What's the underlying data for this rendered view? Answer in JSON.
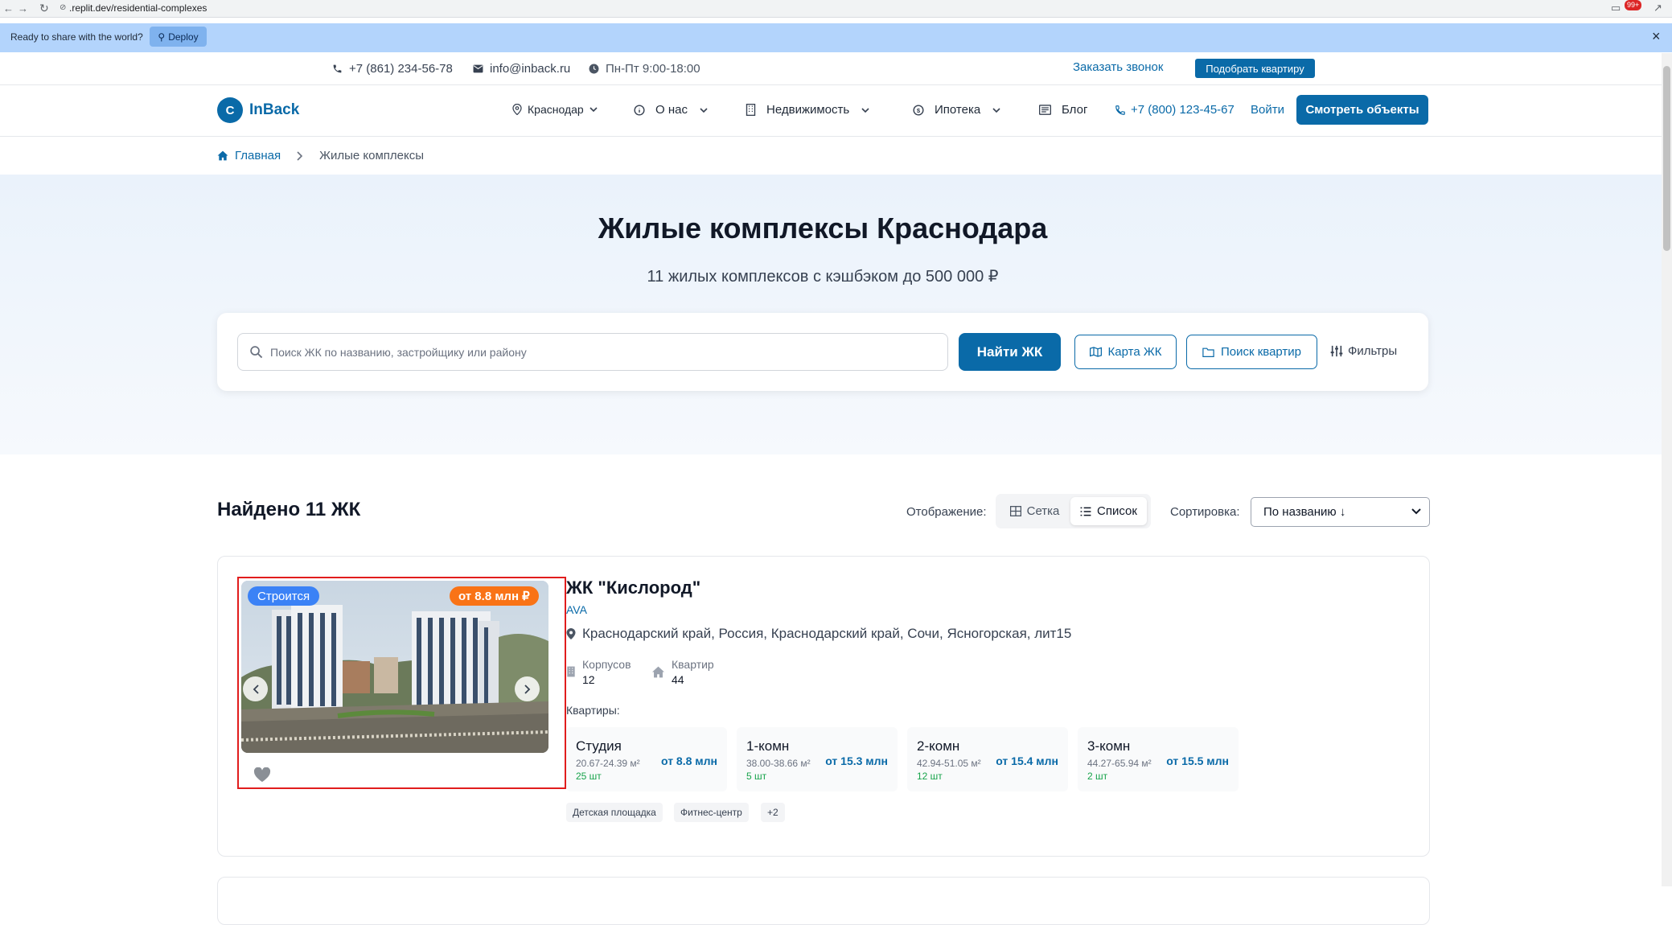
{
  "browser": {
    "url": ".replit.dev/residential-complexes",
    "notification_count": "99+"
  },
  "share_bar": {
    "text": "Ready to share with the world?",
    "deploy_label": "Deploy"
  },
  "topbar": {
    "phone": "+7 (861) 234-56-78",
    "email": "info@inback.ru",
    "hours": "Пн-Пт 9:00-18:00",
    "order_call": "Заказать звонок",
    "pick_flat": "Подобрать квартиру"
  },
  "nav": {
    "logo_letter": "C",
    "logo_text": "InBack",
    "city": "Краснодар",
    "about": "О нас",
    "realty": "Недвижимость",
    "mortgage": "Ипотека",
    "blog": "Блог",
    "phone": "+7 (800) 123-45-67",
    "login": "Войти",
    "cta": "Смотреть объекты"
  },
  "breadcrumb": {
    "home": "Главная",
    "current": "Жилые комплексы"
  },
  "hero": {
    "title": "Жилые комплексы Краснодара",
    "subtitle": "11 жилых комплексов с кэшбэком до 500 000 ₽"
  },
  "search": {
    "placeholder": "Поиск ЖК по названию, застройщику или району",
    "value": "",
    "find_button": "Найти ЖК",
    "map_button": "Карта ЖК",
    "flats_button": "Поиск квартир",
    "filters_button": "Фильтры"
  },
  "results": {
    "found": "Найдено 11 ЖК",
    "display_label": "Отображение:",
    "view_grid": "Сетка",
    "view_list": "Список",
    "sort_label": "Сортировка:",
    "sort_value": "По названию ↓"
  },
  "complex": {
    "status": "Строится",
    "price_badge": "от 8.8 млн ₽",
    "name": "ЖК \"Кислород\"",
    "developer": "AVA",
    "address": "Краснодарский край, Россия, Краснодарский край, Сочи, Ясногорская, лит15",
    "buildings_label": "Корпусов",
    "buildings_value": "12",
    "flats_count_label": "Квартир",
    "flats_count_value": "44",
    "flats_label": "Квартиры:",
    "flat_types": [
      {
        "type": "Студия",
        "area": "20.67-24.39 м²",
        "count": "25 шт",
        "price": "от 8.8 млн"
      },
      {
        "type": "1-комн",
        "area": "38.00-38.66 м²",
        "count": "5 шт",
        "price": "от 15.3 млн"
      },
      {
        "type": "2-комн",
        "area": "42.94-51.05 м²",
        "count": "12 шт",
        "price": "от 15.4 млн"
      },
      {
        "type": "3-комн",
        "area": "44.27-65.94 м²",
        "count": "2 шт",
        "price": "от 15.5 млн"
      }
    ],
    "amenities": [
      "Детская площадка",
      "Фитнес-центр",
      "+2"
    ]
  }
}
